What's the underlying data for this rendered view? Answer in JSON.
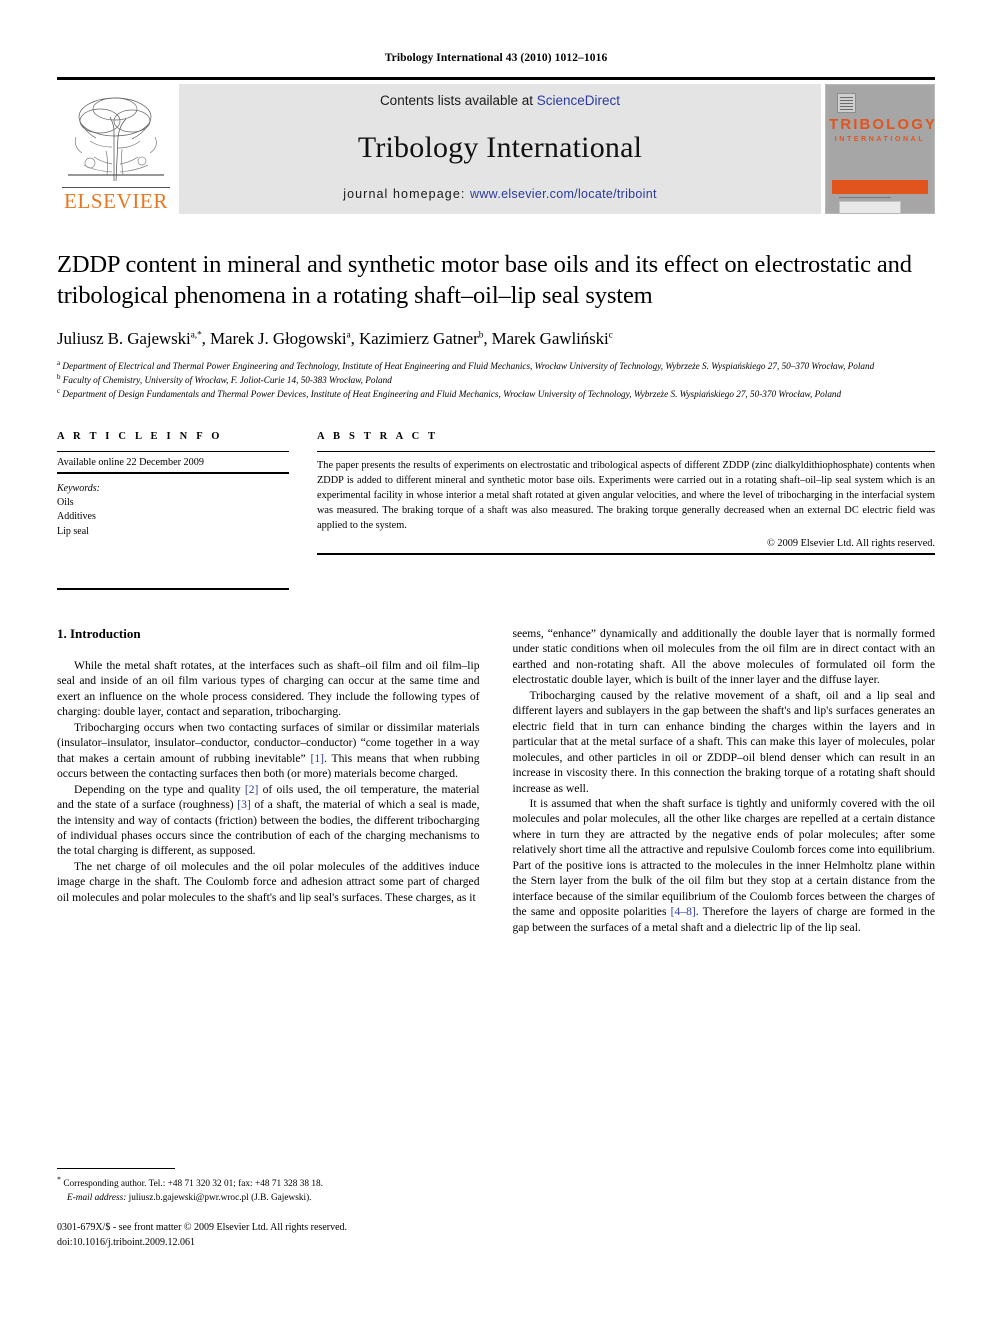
{
  "running_head": "Tribology International 43 (2010) 1012–1016",
  "masthead": {
    "publisher_logo_text": "ELSEVIER",
    "contents_prefix": "Contents lists available at ",
    "contents_link": "ScienceDirect",
    "journal_title": "Tribology International",
    "homepage_prefix": "journal homepage: ",
    "homepage_url": "www.elsevier.com/locate/triboint",
    "cover": {
      "title": "TRIBOLOGY",
      "subtitle": "INTERNATIONAL"
    },
    "colors": {
      "elsevier_orange": "#e87722",
      "cover_orange": "#e2541d",
      "link_blue": "#2b3b9e",
      "band_gray": "#e4e4e4"
    }
  },
  "article": {
    "title": "ZDDP content in mineral and synthetic motor base oils and its effect on electrostatic and tribological phenomena in a rotating shaft–oil–lip seal system",
    "authors": [
      {
        "name": "Juliusz B. Gajewski",
        "marks": "a,*"
      },
      {
        "name": "Marek J. Głogowski",
        "marks": "a"
      },
      {
        "name": "Kazimierz Gatner",
        "marks": "b"
      },
      {
        "name": "Marek Gawliński",
        "marks": "c"
      }
    ],
    "affiliations": [
      {
        "mark": "a",
        "text": "Department of Electrical and Thermal Power Engineering and Technology, Institute of Heat Engineering and Fluid Mechanics, Wrocław University of Technology, Wybrzeże S. Wyspiańskiego 27, 50–370 Wrocław, Poland"
      },
      {
        "mark": "b",
        "text": "Faculty of Chemistry, University of Wrocław, F. Joliot-Curie 14, 50-383 Wrocław, Poland"
      },
      {
        "mark": "c",
        "text": "Department of Design Fundamentals and Thermal Power Devices, Institute of Heat Engineering and Fluid Mechanics, Wrocław University of Technology, Wybrzeże S. Wyspiańskiego 27, 50-370 Wrocław, Poland"
      }
    ]
  },
  "article_info": {
    "heading": "A R T I C L E   I N F O",
    "available_online": "Available online 22 December 2009",
    "keywords_heading": "Keywords:",
    "keywords": [
      "Oils",
      "Additives",
      "Lip seal"
    ]
  },
  "abstract": {
    "heading": "A B S T R A C T",
    "text": "The paper presents the results of experiments on electrostatic and tribological aspects of different ZDDP (zinc dialkyldithiophosphate) contents when ZDDP is added to different mineral and synthetic motor base oils. Experiments were carried out in a rotating shaft–oil–lip seal system which is an experimental facility in whose interior a metal shaft rotated at given angular velocities, and where the level of tribocharging in the interfacial system was measured. The braking torque of a shaft was also measured. The braking torque generally decreased when an external DC electric field was applied to the system.",
    "rights": "© 2009 Elsevier Ltd. All rights reserved."
  },
  "body": {
    "section_title": "1.  Introduction",
    "left_paragraphs": [
      "While the metal shaft rotates, at the interfaces such as shaft–oil film and oil film–lip seal and inside of an oil film various types of charging can occur at the same time and exert an influence on the whole process considered. They include the following types of charging: double layer, contact and separation, tribocharging.",
      "Tribocharging occurs when two contacting surfaces of similar or dissimilar materials (insulator–insulator, insulator–conductor, conductor–conductor) “come together in a way that makes a certain amount of rubbing inevitable” [1]. This means that when rubbing occurs between the contacting surfaces then both (or more) materials become charged.",
      "Depending on the type and quality [2] of oils used, the oil temperature, the material and the state of a surface (roughness) [3] of a shaft, the material of which a seal is made, the intensity and way of contacts (friction) between the bodies, the different tribocharging of individual phases occurs since the contribution of each of the charging mechanisms to the total charging is different, as supposed.",
      "The net charge of oil molecules and the oil polar molecules of the additives induce image charge in the shaft. The Coulomb force and adhesion attract some part of charged oil molecules and polar molecules to the shaft's and lip seal's surfaces. These charges, as it"
    ],
    "right_paragraphs": [
      "seems, “enhance” dynamically and additionally the double layer that is normally formed under static conditions when oil molecules from the oil film are in direct contact with an earthed and non-rotating shaft. All the above molecules of formulated oil form the electrostatic double layer, which is built of the inner layer and the diffuse layer.",
      "Tribocharging caused by the relative movement of a shaft, oil and a lip seal and different layers and sublayers in the gap between the shaft's and lip's surfaces generates an electric field that in turn can enhance binding the charges within the layers and in particular that at the metal surface of a shaft. This can make this layer of molecules, polar molecules, and other particles in oil or ZDDP–oil blend denser which can result in an increase in viscosity there. In this connection the braking torque of a rotating shaft should increase as well.",
      "It is assumed that when the shaft surface is tightly and uniformly covered with the oil molecules and polar molecules, all the other like charges are repelled at a certain distance where in turn they are attracted by the negative ends of polar molecules; after some relatively short time all the attractive and repulsive Coulomb forces come into equilibrium. Part of the positive ions is attracted to the molecules in the inner Helmholtz plane within the Stern layer from the bulk of the oil film but they stop at a certain distance from the interface because of the similar equilibrium of the Coulomb forces between the charges of the same and opposite polarities [4–8]. Therefore the layers of charge are formed in the gap between the surfaces of a metal shaft and a dielectric lip of the lip seal."
    ],
    "citations": {
      "c1": "[1]",
      "c2": "[2]",
      "c3": "[3]",
      "c48": "[4–8]"
    }
  },
  "footnotes": {
    "corresponding": "Corresponding author. Tel.: +48 71 320 32 01; fax: +48 71 328 38 18.",
    "email_label": "E-mail address:",
    "email": "juliusz.b.gajewski@pwr.wroc.pl (J.B. Gajewski).",
    "issn_line": "0301-679X/$ - see front matter © 2009 Elsevier Ltd. All rights reserved.",
    "doi_line": "doi:10.1016/j.triboint.2009.12.061"
  }
}
